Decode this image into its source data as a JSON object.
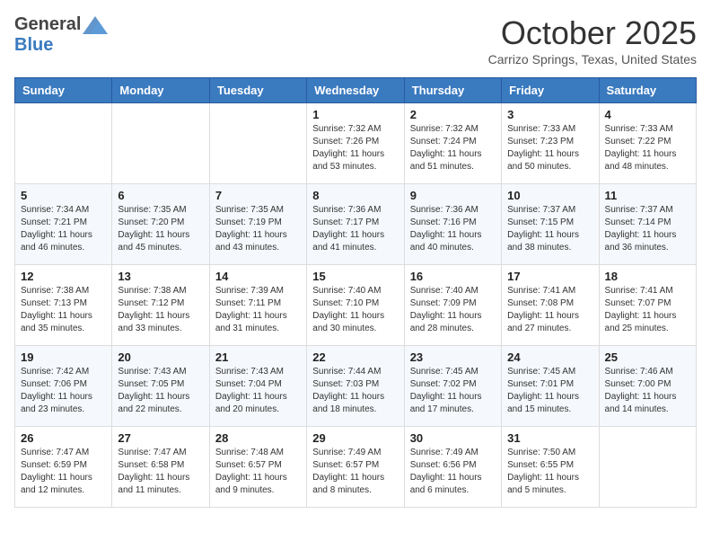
{
  "header": {
    "logo_general": "General",
    "logo_blue": "Blue",
    "month_title": "October 2025",
    "location": "Carrizo Springs, Texas, United States"
  },
  "weekdays": [
    "Sunday",
    "Monday",
    "Tuesday",
    "Wednesday",
    "Thursday",
    "Friday",
    "Saturday"
  ],
  "weeks": [
    [
      {
        "day": "",
        "info": ""
      },
      {
        "day": "",
        "info": ""
      },
      {
        "day": "",
        "info": ""
      },
      {
        "day": "1",
        "info": "Sunrise: 7:32 AM\nSunset: 7:26 PM\nDaylight: 11 hours\nand 53 minutes."
      },
      {
        "day": "2",
        "info": "Sunrise: 7:32 AM\nSunset: 7:24 PM\nDaylight: 11 hours\nand 51 minutes."
      },
      {
        "day": "3",
        "info": "Sunrise: 7:33 AM\nSunset: 7:23 PM\nDaylight: 11 hours\nand 50 minutes."
      },
      {
        "day": "4",
        "info": "Sunrise: 7:33 AM\nSunset: 7:22 PM\nDaylight: 11 hours\nand 48 minutes."
      }
    ],
    [
      {
        "day": "5",
        "info": "Sunrise: 7:34 AM\nSunset: 7:21 PM\nDaylight: 11 hours\nand 46 minutes."
      },
      {
        "day": "6",
        "info": "Sunrise: 7:35 AM\nSunset: 7:20 PM\nDaylight: 11 hours\nand 45 minutes."
      },
      {
        "day": "7",
        "info": "Sunrise: 7:35 AM\nSunset: 7:19 PM\nDaylight: 11 hours\nand 43 minutes."
      },
      {
        "day": "8",
        "info": "Sunrise: 7:36 AM\nSunset: 7:17 PM\nDaylight: 11 hours\nand 41 minutes."
      },
      {
        "day": "9",
        "info": "Sunrise: 7:36 AM\nSunset: 7:16 PM\nDaylight: 11 hours\nand 40 minutes."
      },
      {
        "day": "10",
        "info": "Sunrise: 7:37 AM\nSunset: 7:15 PM\nDaylight: 11 hours\nand 38 minutes."
      },
      {
        "day": "11",
        "info": "Sunrise: 7:37 AM\nSunset: 7:14 PM\nDaylight: 11 hours\nand 36 minutes."
      }
    ],
    [
      {
        "day": "12",
        "info": "Sunrise: 7:38 AM\nSunset: 7:13 PM\nDaylight: 11 hours\nand 35 minutes."
      },
      {
        "day": "13",
        "info": "Sunrise: 7:38 AM\nSunset: 7:12 PM\nDaylight: 11 hours\nand 33 minutes."
      },
      {
        "day": "14",
        "info": "Sunrise: 7:39 AM\nSunset: 7:11 PM\nDaylight: 11 hours\nand 31 minutes."
      },
      {
        "day": "15",
        "info": "Sunrise: 7:40 AM\nSunset: 7:10 PM\nDaylight: 11 hours\nand 30 minutes."
      },
      {
        "day": "16",
        "info": "Sunrise: 7:40 AM\nSunset: 7:09 PM\nDaylight: 11 hours\nand 28 minutes."
      },
      {
        "day": "17",
        "info": "Sunrise: 7:41 AM\nSunset: 7:08 PM\nDaylight: 11 hours\nand 27 minutes."
      },
      {
        "day": "18",
        "info": "Sunrise: 7:41 AM\nSunset: 7:07 PM\nDaylight: 11 hours\nand 25 minutes."
      }
    ],
    [
      {
        "day": "19",
        "info": "Sunrise: 7:42 AM\nSunset: 7:06 PM\nDaylight: 11 hours\nand 23 minutes."
      },
      {
        "day": "20",
        "info": "Sunrise: 7:43 AM\nSunset: 7:05 PM\nDaylight: 11 hours\nand 22 minutes."
      },
      {
        "day": "21",
        "info": "Sunrise: 7:43 AM\nSunset: 7:04 PM\nDaylight: 11 hours\nand 20 minutes."
      },
      {
        "day": "22",
        "info": "Sunrise: 7:44 AM\nSunset: 7:03 PM\nDaylight: 11 hours\nand 18 minutes."
      },
      {
        "day": "23",
        "info": "Sunrise: 7:45 AM\nSunset: 7:02 PM\nDaylight: 11 hours\nand 17 minutes."
      },
      {
        "day": "24",
        "info": "Sunrise: 7:45 AM\nSunset: 7:01 PM\nDaylight: 11 hours\nand 15 minutes."
      },
      {
        "day": "25",
        "info": "Sunrise: 7:46 AM\nSunset: 7:00 PM\nDaylight: 11 hours\nand 14 minutes."
      }
    ],
    [
      {
        "day": "26",
        "info": "Sunrise: 7:47 AM\nSunset: 6:59 PM\nDaylight: 11 hours\nand 12 minutes."
      },
      {
        "day": "27",
        "info": "Sunrise: 7:47 AM\nSunset: 6:58 PM\nDaylight: 11 hours\nand 11 minutes."
      },
      {
        "day": "28",
        "info": "Sunrise: 7:48 AM\nSunset: 6:57 PM\nDaylight: 11 hours\nand 9 minutes."
      },
      {
        "day": "29",
        "info": "Sunrise: 7:49 AM\nSunset: 6:57 PM\nDaylight: 11 hours\nand 8 minutes."
      },
      {
        "day": "30",
        "info": "Sunrise: 7:49 AM\nSunset: 6:56 PM\nDaylight: 11 hours\nand 6 minutes."
      },
      {
        "day": "31",
        "info": "Sunrise: 7:50 AM\nSunset: 6:55 PM\nDaylight: 11 hours\nand 5 minutes."
      },
      {
        "day": "",
        "info": ""
      }
    ]
  ]
}
